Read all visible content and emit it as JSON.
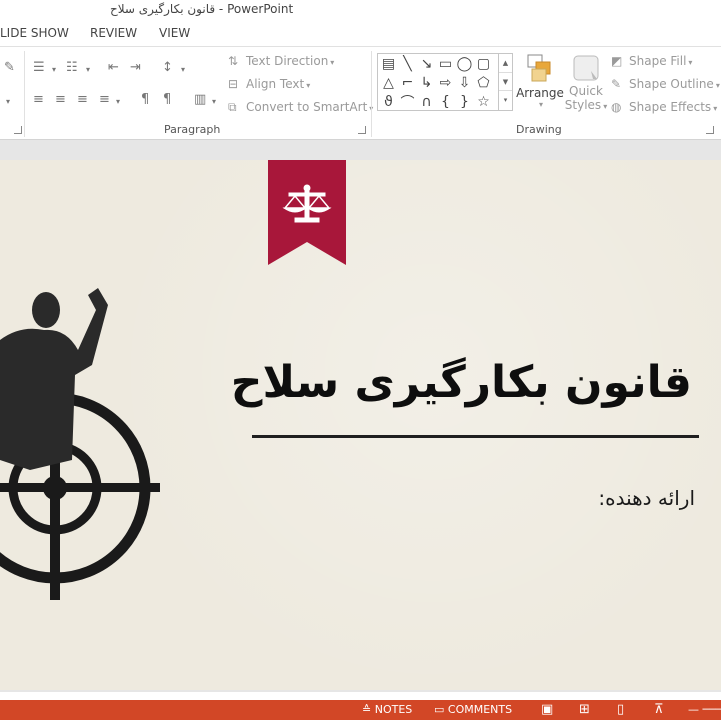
{
  "window": {
    "title": "قانون بکارگیری سلاح - PowerPoint"
  },
  "tabs": [
    {
      "label": "LIDE SHOW"
    },
    {
      "label": "REVIEW"
    },
    {
      "label": "VIEW"
    }
  ],
  "ribbon": {
    "paragraph": {
      "label": "Paragraph",
      "text_direction": "Text Direction",
      "align_text": "Align Text",
      "convert_smartart": "Convert to SmartArt"
    },
    "drawing": {
      "label": "Drawing",
      "arrange": "Arrange",
      "quick_styles_1": "Quick",
      "quick_styles_2": "Styles",
      "shape_fill": "Shape Fill",
      "shape_outline": "Shape Outline",
      "shape_effects": "Shape Effects"
    }
  },
  "slide": {
    "title": "قانون بکارگیری سلاح",
    "subtitle": "ارائه دهنده:"
  },
  "statusbar": {
    "notes": "NOTES",
    "comments": "COMMENTS"
  },
  "colors": {
    "accent": "#d24726",
    "banner": "#a8173a",
    "slide_bg": "#eeeadf",
    "title_line": "#1f1f1f"
  }
}
